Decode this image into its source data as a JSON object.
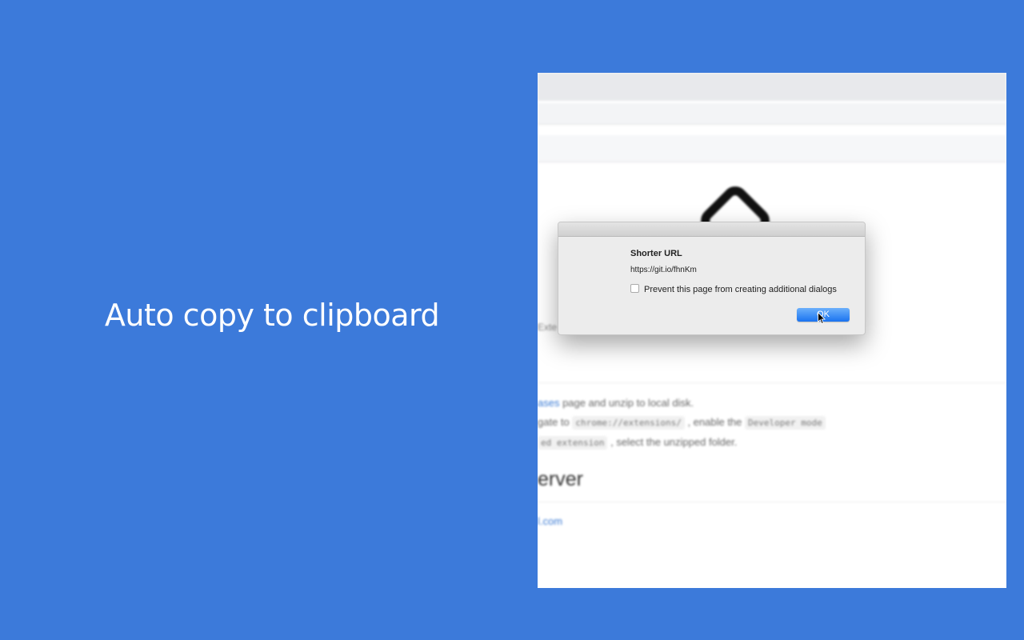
{
  "headline": "Auto copy to clipboard",
  "background_page": {
    "truncated_label": "Exte",
    "step_lines": [
      {
        "link": "ases",
        "text": " page and unzip to local disk."
      },
      {
        "prefix": "gate to ",
        "code1": "chrome://extensions/",
        "middle": " , enable the ",
        "code2": "Developer mode"
      },
      {
        "code": "ed extension",
        "text": " , select the unzipped folder."
      }
    ],
    "section_heading": "erver",
    "footer_link": "l.com"
  },
  "dialog": {
    "title": "Shorter URL",
    "message": "https://git.io/fhnKm",
    "checkbox_label": "Prevent this page from creating additional dialogs",
    "checkbox_checked": false,
    "ok_label": "OK"
  },
  "colors": {
    "background": "#3c7ada",
    "ok_button": "#1a73f0",
    "link": "#3b7bd4"
  }
}
